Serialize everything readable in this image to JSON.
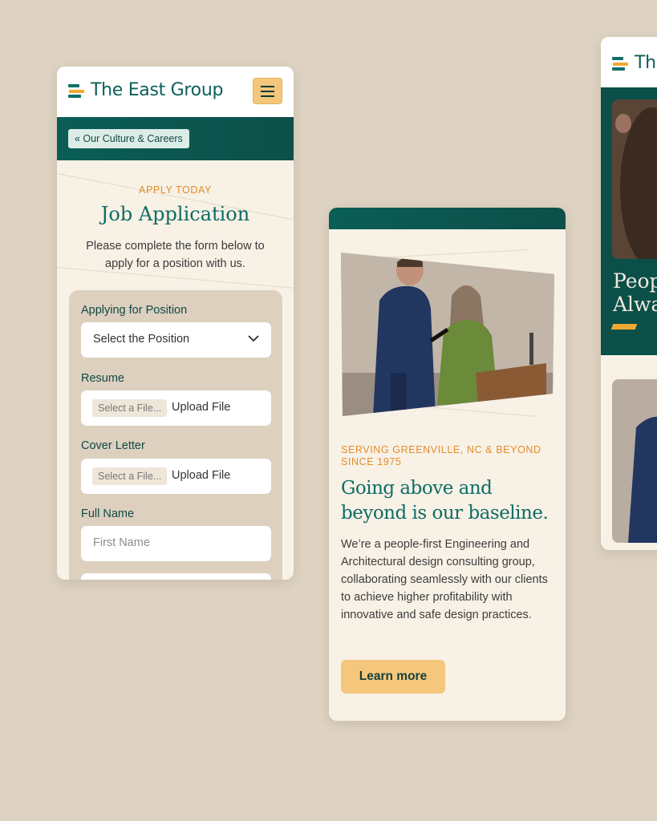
{
  "brand": {
    "name": "The East Group",
    "name_partial": "Th"
  },
  "colors": {
    "teal": "#0b5f58",
    "accent": "#f4c77c",
    "orange": "#e28d2a",
    "background": "#ded2c2",
    "card": "#f8f1e6"
  },
  "card_application": {
    "header": {
      "logo_icon": "east-group-logo-icon",
      "menu_icon": "hamburger-menu-icon"
    },
    "breadcrumb": "« Our Culture & Careers",
    "eyebrow": "APPLY TODAY",
    "title": "Job Application",
    "intro": "Please complete the form below to apply for a position with us.",
    "form": {
      "position": {
        "label": "Applying for Position",
        "selected": "Select the Position"
      },
      "resume": {
        "label": "Resume",
        "file_placeholder": "Select a File...",
        "button": "Upload File"
      },
      "cover_letter": {
        "label": "Cover Letter",
        "file_placeholder": "Select a File...",
        "button": "Upload File"
      },
      "full_name": {
        "label": "Full Name",
        "first_placeholder": "First Name"
      }
    }
  },
  "card_about": {
    "eyebrow": "SERVING GREENVILLE, NC & BEYOND SINCE 1975",
    "title": "Going above and beyond is our baseline.",
    "body": "We’re a people-first Engineering and Architectural design consulting group, collaborating seamlessly with our clients to achieve higher profitability with innovative and safe design practices.",
    "cta": "Learn more"
  },
  "card_partial": {
    "hero_line1": "Peop",
    "hero_line2": "Alwa"
  }
}
